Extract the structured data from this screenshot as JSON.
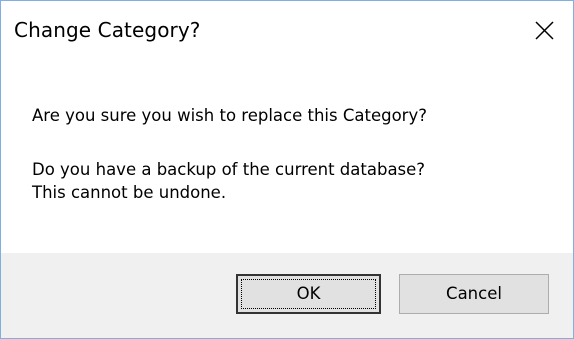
{
  "window": {
    "title": "Change Category?",
    "close_icon": "close-icon"
  },
  "message": {
    "line1": "Are you sure you wish to replace this Category?",
    "line2": "Do you have a backup of the current database?",
    "line3": "This cannot be undone."
  },
  "buttons": {
    "ok_label": "OK",
    "cancel_label": "Cancel"
  },
  "colors": {
    "border": "#7fb0e0",
    "footer_background": "#f0f0f0",
    "button_background": "#e1e1e1"
  }
}
